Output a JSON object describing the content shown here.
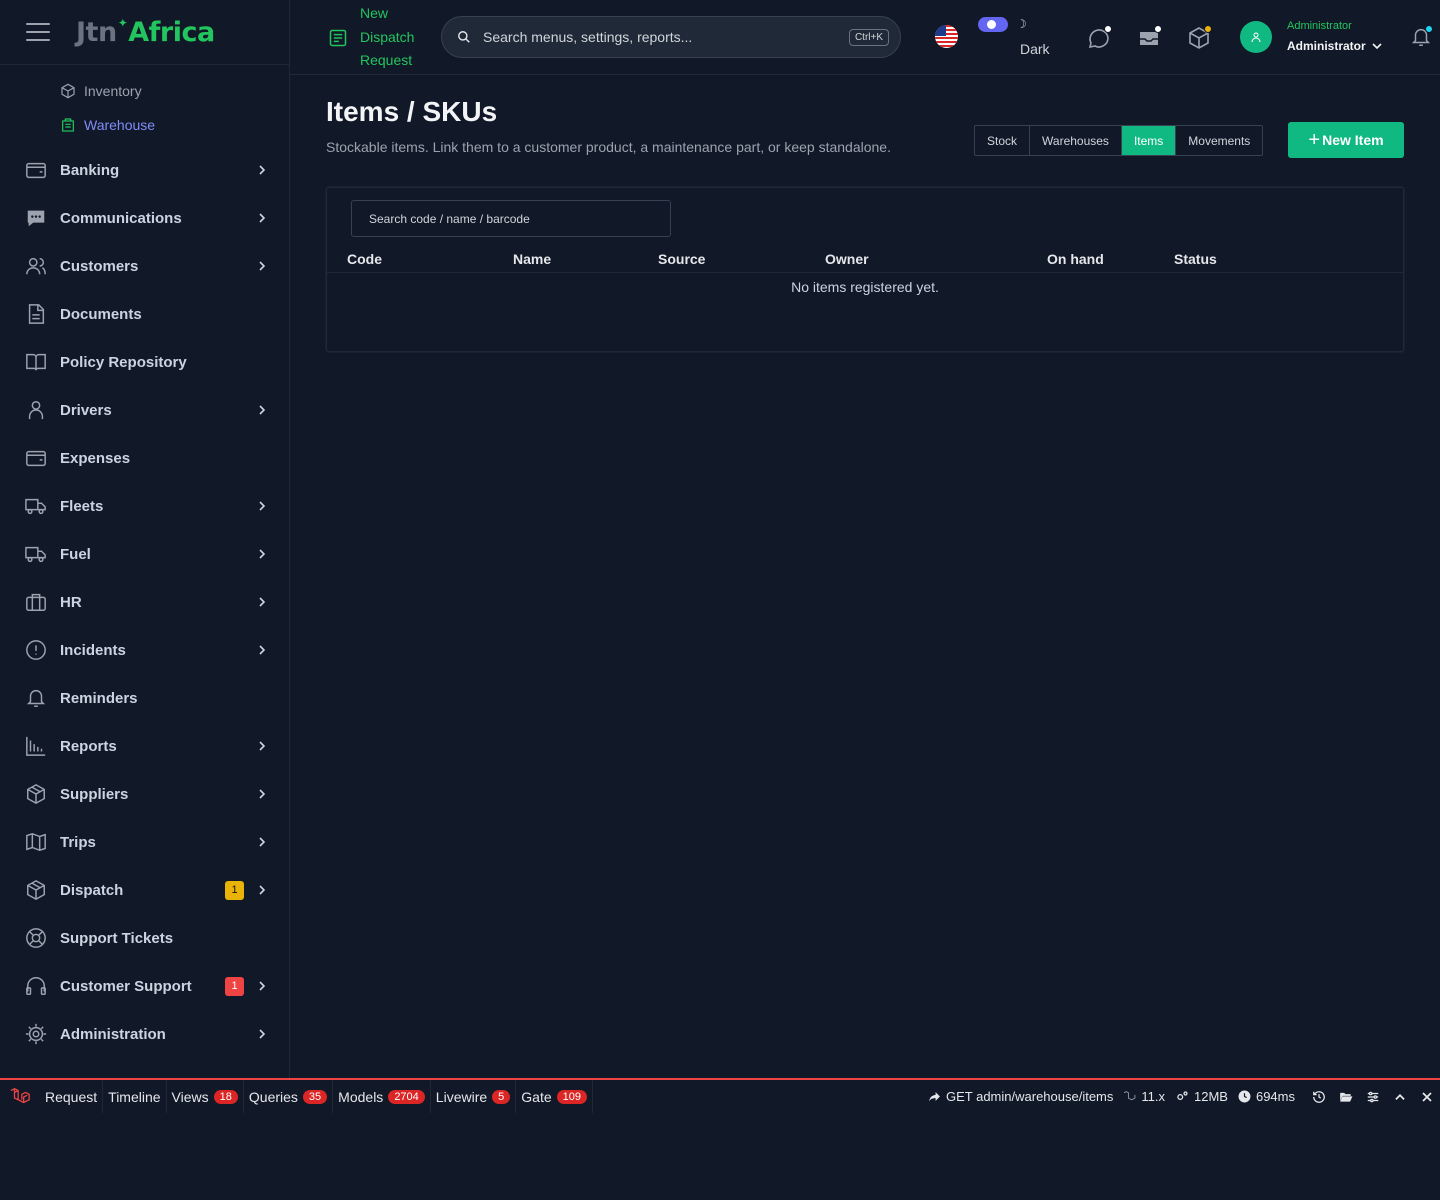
{
  "brand": {
    "jtn": "Jtn",
    "africa": "Africa"
  },
  "sidebar": {
    "subitems": [
      {
        "label": "Inventory"
      },
      {
        "label": "Warehouse"
      }
    ],
    "items": [
      {
        "label": "Banking",
        "icon": "wallet-icon"
      },
      {
        "label": "Communications",
        "icon": "chat-icon"
      },
      {
        "label": "Customers",
        "icon": "users-icon"
      },
      {
        "label": "Documents",
        "icon": "document-icon"
      },
      {
        "label": "Policy Repository",
        "icon": "book-icon"
      },
      {
        "label": "Drivers",
        "icon": "user-icon"
      },
      {
        "label": "Expenses",
        "icon": "wallet-icon"
      },
      {
        "label": "Fleets",
        "icon": "truck-icon"
      },
      {
        "label": "Fuel",
        "icon": "truck-icon"
      },
      {
        "label": "HR",
        "icon": "briefcase-icon"
      },
      {
        "label": "Incidents",
        "icon": "alert-icon"
      },
      {
        "label": "Reminders",
        "icon": "bell-icon"
      },
      {
        "label": "Reports",
        "icon": "bar-chart-icon"
      },
      {
        "label": "Suppliers",
        "icon": "cube-icon"
      },
      {
        "label": "Trips",
        "icon": "map-icon"
      },
      {
        "label": "Dispatch",
        "icon": "cube-icon",
        "badge": "1"
      },
      {
        "label": "Support Tickets",
        "icon": "lifebuoy-icon"
      },
      {
        "label": "Customer Support",
        "icon": "headset-icon",
        "badge": "1"
      },
      {
        "label": "Administration",
        "icon": "gear-icon"
      }
    ]
  },
  "topbar": {
    "quick_link": "New Dispatch Request",
    "search_placeholder": "Search menus, settings, reports...",
    "search_shortcut": "Ctrl+K",
    "theme_label": "Dark",
    "user_role": "Administrator",
    "user_name": "Administrator"
  },
  "page": {
    "title": "Items / SKUs",
    "subtitle": "Stockable items. Link them to a customer product, a maintenance part, or keep standalone.",
    "tabs": [
      "Stock",
      "Warehouses",
      "Items",
      "Movements"
    ],
    "active_tab": "Items",
    "new_button": "New Item",
    "table_search_placeholder": "Search code / name / barcode",
    "columns": [
      "Code",
      "Name",
      "Source",
      "Owner",
      "On hand",
      "Status"
    ],
    "empty_message": "No items registered yet."
  },
  "debugbar": {
    "tabs": [
      {
        "label": "Request"
      },
      {
        "label": "Timeline"
      },
      {
        "label": "Views",
        "count": "18"
      },
      {
        "label": "Queries",
        "count": "35"
      },
      {
        "label": "Models",
        "count": "2704"
      },
      {
        "label": "Livewire",
        "count": "5"
      },
      {
        "label": "Gate",
        "count": "109"
      }
    ],
    "route": "GET admin/warehouse/items",
    "version": "11.x",
    "memory": "12MB",
    "time": "694ms"
  },
  "colors": {
    "accent": "#10b981",
    "brand_green": "#22c55e",
    "active_sub": "#818cf8",
    "debug_red": "#ef4444",
    "background": "#111827"
  }
}
